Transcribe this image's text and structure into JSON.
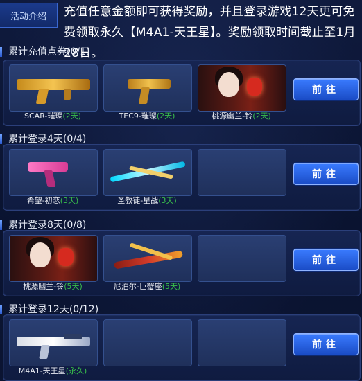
{
  "intro": {
    "tag": "活动介绍",
    "text": "充值任意金额即可获得奖励，并且登录游戏12天更可免费领取永久【M4A1-天王星】。奖励领取时间截止至1月28日。"
  },
  "sections": [
    {
      "title": "累计充值点券(0/1)",
      "button": "前往",
      "items": [
        {
          "name": "SCAR-璀璨",
          "duration": "(2天)"
        },
        {
          "name": "TEC9-璀璨",
          "duration": "(2天)"
        },
        {
          "name": "桃源幽兰-铃",
          "duration": "(2天)"
        }
      ]
    },
    {
      "title": "累计登录4天(0/4)",
      "button": "前往",
      "items": [
        {
          "name": "希望-初恋",
          "duration": "(3天)"
        },
        {
          "name": "圣教徒-星战",
          "duration": "(3天)"
        },
        {
          "name": "",
          "duration": ""
        }
      ]
    },
    {
      "title": "累计登录8天(0/8)",
      "button": "前往",
      "items": [
        {
          "name": "桃源幽兰-铃",
          "duration": "(5天)"
        },
        {
          "name": "尼泊尔-巨蟹座",
          "duration": "(5天)"
        },
        {
          "name": "",
          "duration": ""
        }
      ]
    },
    {
      "title": "累计登录12天(0/12)",
      "button": "前往",
      "items": [
        {
          "name": "M4A1-天王星",
          "duration": "(永久)"
        },
        {
          "name": "",
          "duration": ""
        },
        {
          "name": "",
          "duration": ""
        }
      ]
    }
  ],
  "colors": {
    "duration_green": "#39c14b",
    "button_blue": "#1a4cc6",
    "panel_bg": "#162552"
  }
}
